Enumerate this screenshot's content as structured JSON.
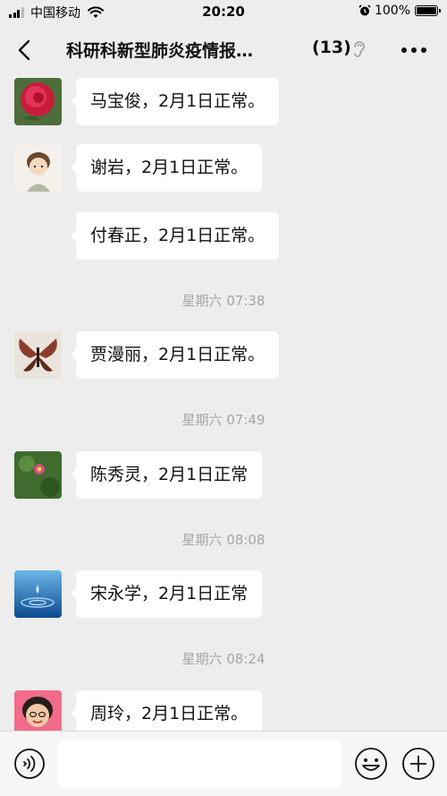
{
  "status": {
    "carrier": "中国移动",
    "time": "20:20",
    "battery": "100%"
  },
  "header": {
    "title": "科研科新型肺炎疫情报…",
    "member_count": "(13)"
  },
  "messages": [
    {
      "sender_avatar": "rose-photo",
      "text": "马宝俊，2月1日正常。"
    },
    {
      "sender_avatar": "cartoon-girl",
      "text": "谢岩，2月1日正常。"
    },
    {
      "sender_avatar": "blank",
      "text": "付春正，2月1日正常。"
    },
    {
      "time": "星期六 07:38"
    },
    {
      "sender_avatar": "butterfly-photo",
      "text": "贾漫丽，2月1日正常。"
    },
    {
      "time": "星期六 07:49"
    },
    {
      "sender_avatar": "green-flower-photo",
      "text": "陈秀灵，2月1日正常"
    },
    {
      "time": "星期六 08:08"
    },
    {
      "sender_avatar": "water-drop-photo",
      "text": "宋永学，2月1日正常"
    },
    {
      "time": "星期六 08:24"
    },
    {
      "sender_avatar": "woman-portrait",
      "text": "周玲，2月1日正常。"
    }
  ],
  "input": {
    "placeholder": ""
  },
  "colors": {
    "background": "#ededed",
    "bubble": "#ffffff",
    "timestamp": "#a6a6a6"
  },
  "icons": [
    "back-chevron-icon",
    "ear-icon",
    "more-dots-icon",
    "voice-icon",
    "emoji-icon",
    "plus-icon"
  ]
}
